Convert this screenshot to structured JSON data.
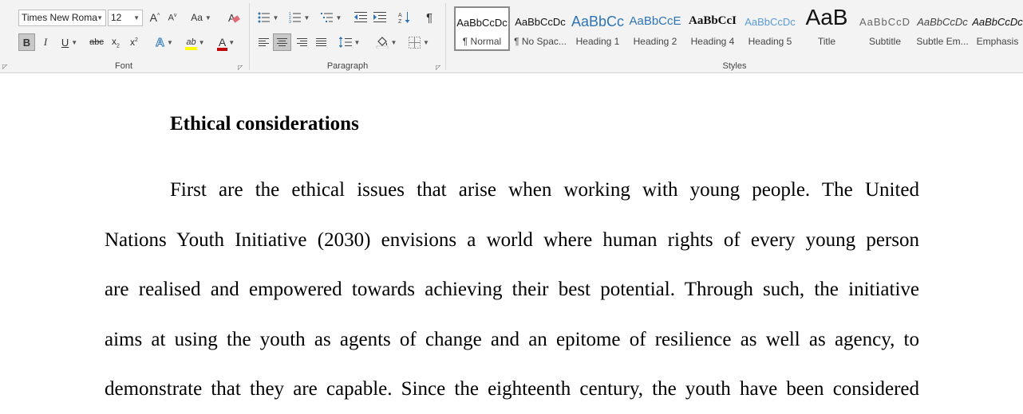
{
  "ribbon": {
    "font": {
      "group_label": "Font",
      "font_name": "Times New Roma",
      "font_size": "12",
      "grow_glyph": "A",
      "shrink_glyph": "A",
      "change_case_glyph": "Aa",
      "bold": "B",
      "italic": "I",
      "underline": "U",
      "strikethrough": "abc",
      "subscript": "x",
      "subscript_mark": "2",
      "superscript": "x",
      "superscript_mark": "2",
      "text_effects": "A",
      "highlight": "ab",
      "font_color": "A"
    },
    "paragraph": {
      "group_label": "Paragraph",
      "pilcrow": "¶"
    },
    "styles": {
      "group_label": "Styles",
      "items": [
        {
          "sample": "AaBbCcDc",
          "name": "¶ Normal"
        },
        {
          "sample": "AaBbCcDc",
          "name": "¶ No Spac..."
        },
        {
          "sample": "AaBbCc",
          "name": "Heading 1"
        },
        {
          "sample": "AaBbCcE",
          "name": "Heading 2"
        },
        {
          "sample": "AaBbCcI",
          "name": "Heading 4"
        },
        {
          "sample": "AaBbCcDc",
          "name": "Heading 5"
        },
        {
          "sample": "AaB",
          "name": "Title"
        },
        {
          "sample": "AaBbCcD",
          "name": "Subtitle"
        },
        {
          "sample": "AaBbCcDc",
          "name": "Subtle Em..."
        },
        {
          "sample": "AaBbCcDc",
          "name": "Emphasis"
        }
      ]
    }
  },
  "colors": {
    "highlight": "#ffff00",
    "font_color": "#c00000",
    "heading_blue": "#2e74b5",
    "heading_light_blue": "#5b9bd5"
  },
  "document": {
    "heading": "Ethical considerations",
    "lines": [
      "First are the ethical issues that arise when working with young people. The United",
      "Nations Youth Initiative (2030) envisions a world where human rights of every young person",
      "are realised and empowered towards achieving their best potential. Through such, the initiative",
      "aims at using the youth as agents of change and an epitome of resilience as well as agency, to",
      "demonstrate that they are capable. Since the eighteenth century, the youth have been considered"
    ]
  }
}
